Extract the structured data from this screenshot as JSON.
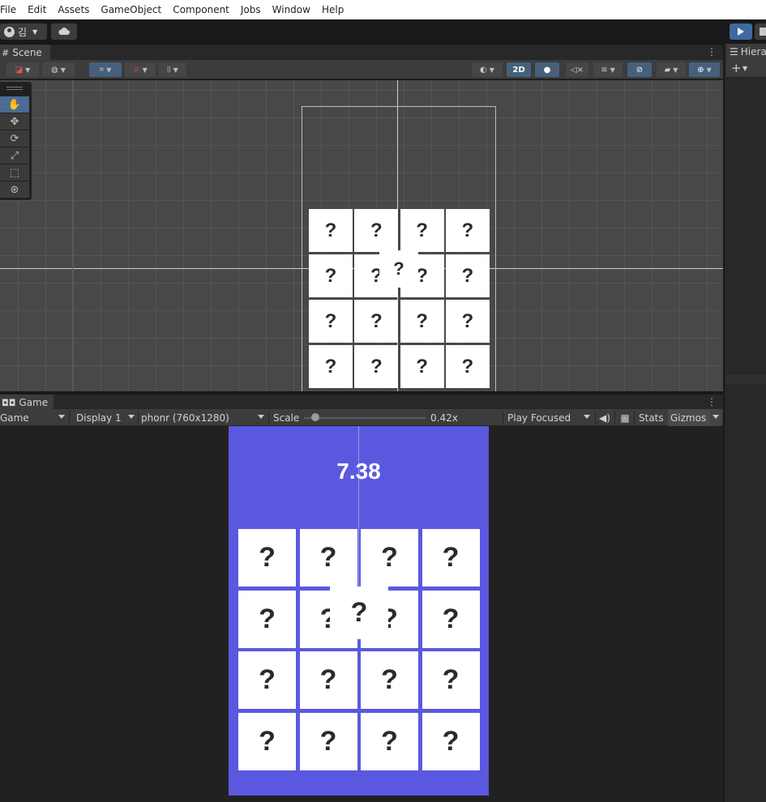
{
  "menu": [
    "File",
    "Edit",
    "Assets",
    "GameObject",
    "Component",
    "Jobs",
    "Window",
    "Help"
  ],
  "account": {
    "label": "김"
  },
  "scene": {
    "tab_label": "Scene",
    "toolbar_2d_label": "2D",
    "card_glyph": "?",
    "overlay_glyph": "?"
  },
  "game": {
    "tab_label": "Game",
    "mode_label": "Game",
    "display_label": "Display 1",
    "resolution_label": "phonr (760x1280)",
    "scale_label": "Scale",
    "scale_value": "0.42x",
    "scale_fraction": 0.06,
    "play_mode_label": "Play Focused",
    "stats_label": "Stats",
    "gizmos_label": "Gizmos",
    "timer": "7.38",
    "card_glyph": "?",
    "overlay_glyph": "?",
    "grid": {
      "rows": 4,
      "cols": 4
    }
  },
  "hierarchy": {
    "tab_label": "Hiera"
  },
  "colors": {
    "game_background": "#5b58e0",
    "card": "#ffffff",
    "play_button": "#3e6aa0"
  }
}
